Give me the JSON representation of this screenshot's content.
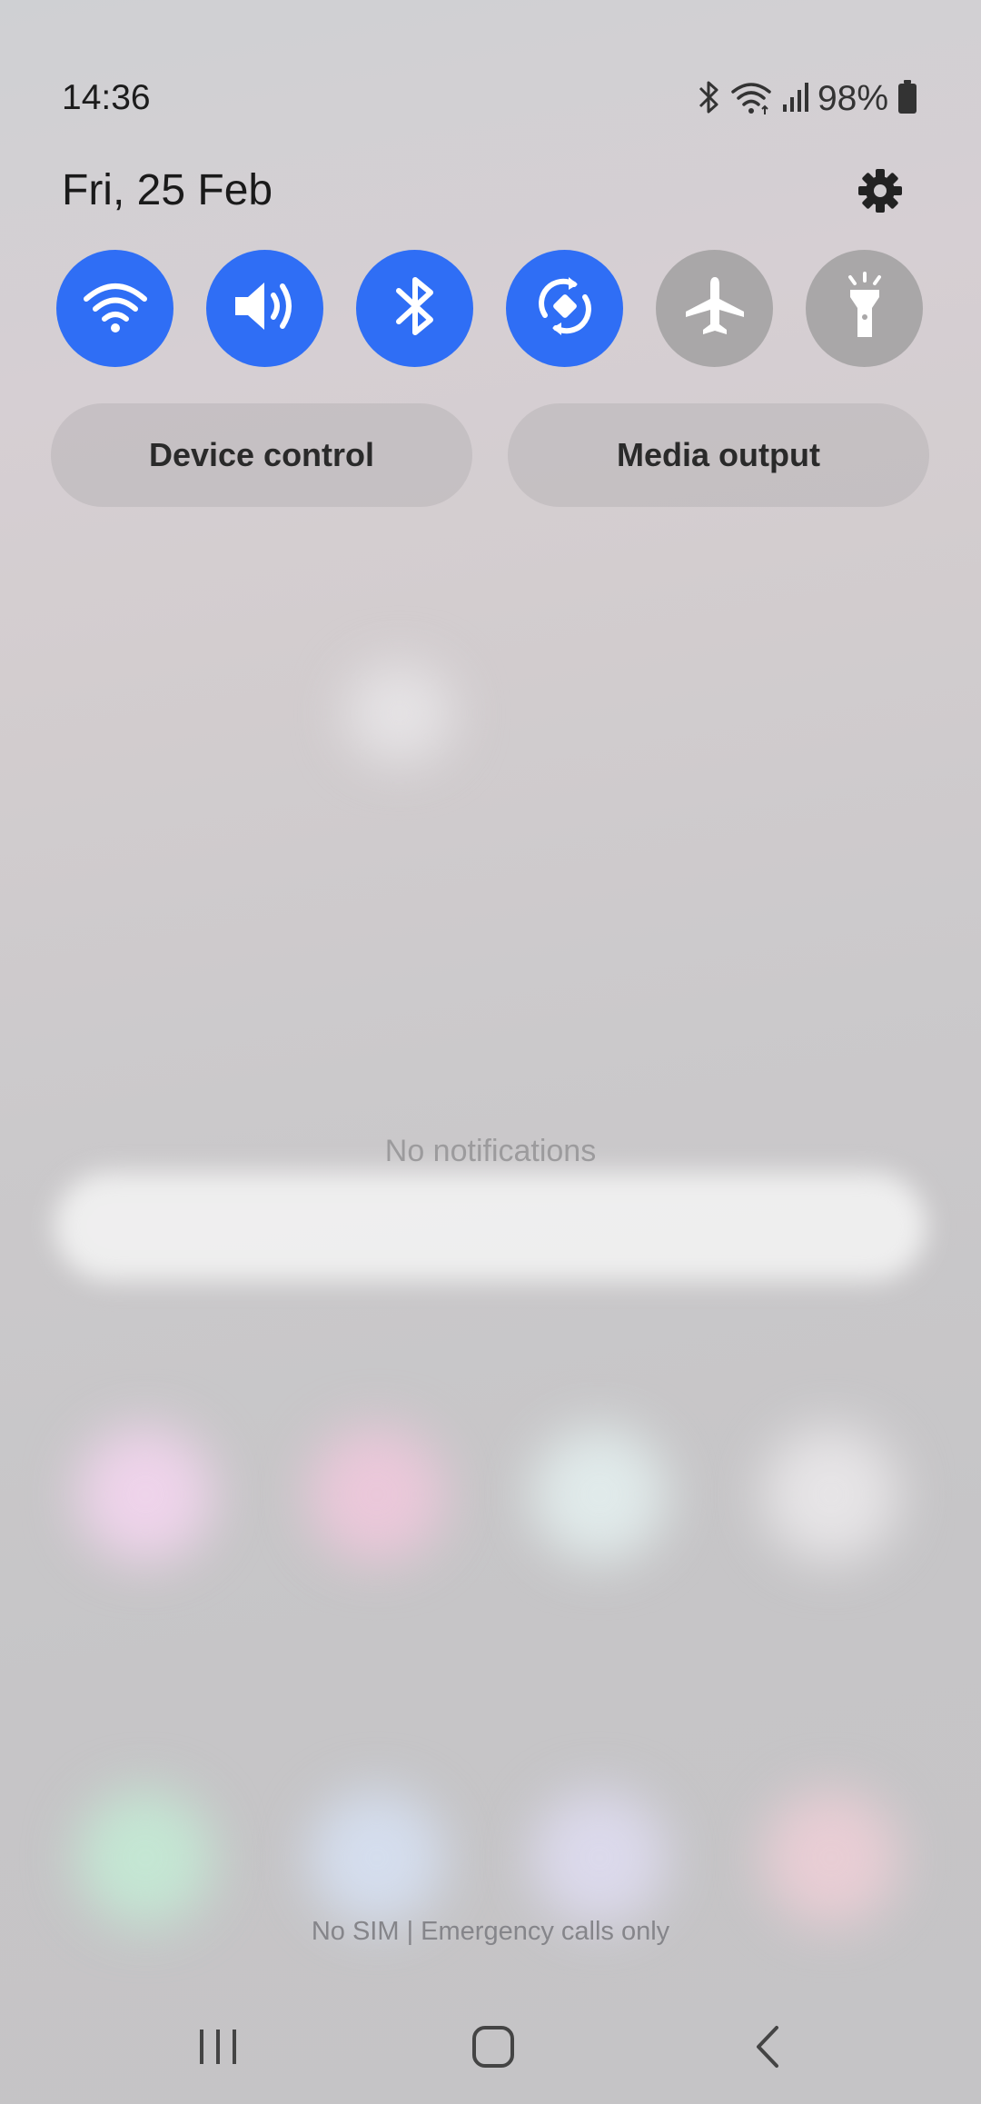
{
  "status_bar": {
    "time": "14:36",
    "battery": "98%",
    "icons": [
      "bluetooth-icon",
      "wifi-icon",
      "signal-icon",
      "battery-icon"
    ]
  },
  "panel": {
    "date": "Fri, 25 Feb",
    "settings_icon": "gear-icon"
  },
  "quick_tiles": [
    {
      "icon": "wifi-icon",
      "state": "on"
    },
    {
      "icon": "sound-icon",
      "state": "on"
    },
    {
      "icon": "bluetooth-icon",
      "state": "on"
    },
    {
      "icon": "auto-rotate-icon",
      "state": "on"
    },
    {
      "icon": "airplane-icon",
      "state": "off"
    },
    {
      "icon": "flashlight-icon",
      "state": "off"
    }
  ],
  "buttons": {
    "device_control": "Device control",
    "media_output": "Media output"
  },
  "notifications": {
    "empty_text": "No notifications"
  },
  "footer": {
    "sim_status": "No SIM | Emergency calls only"
  },
  "navigation": {
    "recents_icon": "recents-icon",
    "home_icon": "home-icon",
    "back_icon": "back-icon"
  },
  "colors": {
    "tile_on": "#2f6ef5",
    "tile_off": "#a9a7a8"
  }
}
